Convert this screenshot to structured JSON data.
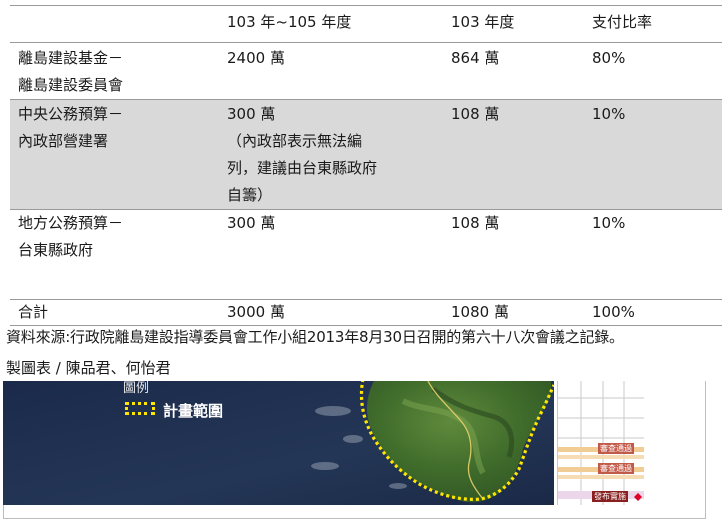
{
  "table": {
    "header": [
      "",
      "103 年~105 年度",
      "103 年度",
      "支付比率"
    ],
    "rows": [
      {
        "source_lines": [
          "離島建設基金－",
          "離島建設委員會"
        ],
        "amount_lines": [
          "2400 萬"
        ],
        "year103": "864 萬",
        "ratio": "80%"
      },
      {
        "source_lines": [
          "中央公務預算－",
          "內政部營建署"
        ],
        "amount_lines": [
          "300 萬",
          "（內政部表示無法編",
          "列，建議由台東縣政府",
          "自籌）"
        ],
        "year103": "108 萬",
        "ratio": "10%"
      },
      {
        "source_lines": [
          "地方公務預算－",
          "台東縣政府"
        ],
        "amount_lines": [
          "300 萬"
        ],
        "year103": "108 萬",
        "ratio": "10%"
      }
    ],
    "total": {
      "label": "合計",
      "amount": "3000 萬",
      "year103": "1080 萬",
      "ratio": "100%"
    }
  },
  "source_note": "資料來源:行政院離島建設指導委員會工作小組2013年8月30日召開的第六十八次會議之記錄。",
  "credit": "製圖表 / 陳品君、何怡君",
  "map": {
    "legend_title": "圖例",
    "legend_label": "計畫範圍",
    "boundary_color": "#ffe600"
  },
  "gantt": {
    "tag1": "審查通過",
    "tag2": "審查通過",
    "tag3": "發布實施"
  }
}
